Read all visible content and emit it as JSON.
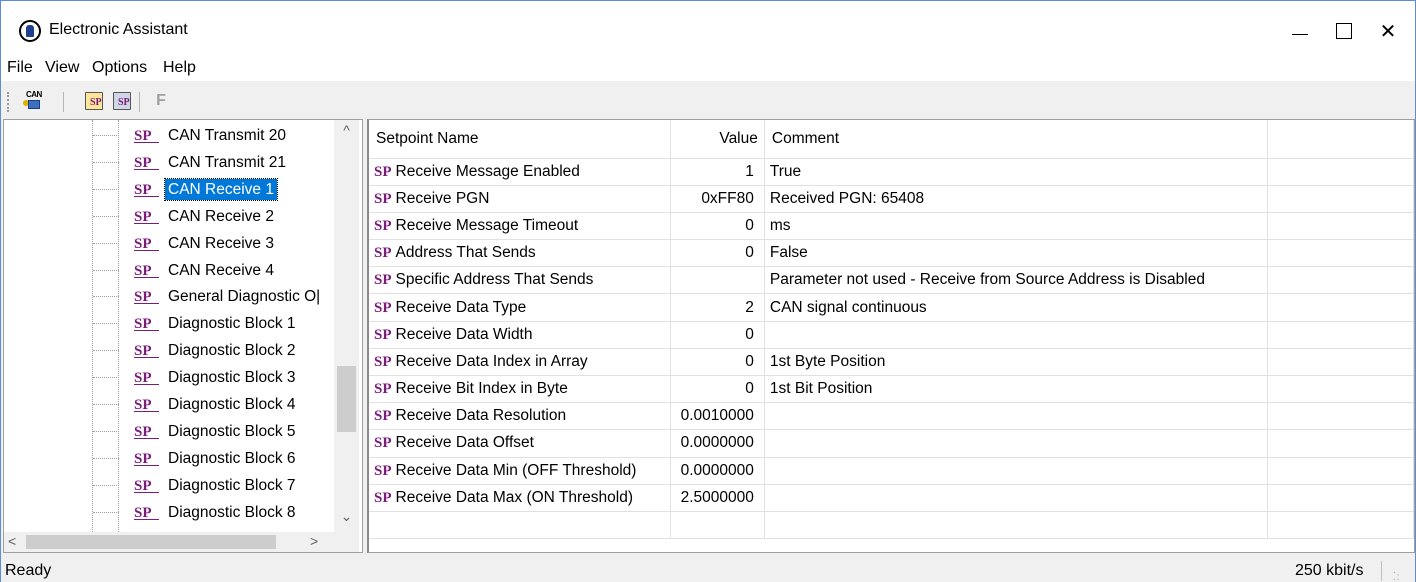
{
  "window": {
    "title": "Electronic Assistant",
    "minimize": "—",
    "maximize": "",
    "close": "✕"
  },
  "menu": [
    "File",
    "View",
    "Options",
    "Help"
  ],
  "toolbar": {
    "can_label": "CAN",
    "open_icon_text": "SP",
    "save_icon_text": "SP",
    "f_label": "F"
  },
  "tree": {
    "icon_text": "SP",
    "items": [
      {
        "label": "CAN Transmit 20",
        "selected": false
      },
      {
        "label": "CAN Transmit 21",
        "selected": false
      },
      {
        "label": "CAN Receive 1",
        "selected": true
      },
      {
        "label": "CAN Receive 2",
        "selected": false
      },
      {
        "label": "CAN Receive 3",
        "selected": false
      },
      {
        "label": "CAN Receive 4",
        "selected": false
      },
      {
        "label": "General Diagnostic O|",
        "selected": false
      },
      {
        "label": "Diagnostic Block 1",
        "selected": false
      },
      {
        "label": "Diagnostic Block 2",
        "selected": false
      },
      {
        "label": "Diagnostic Block 3",
        "selected": false
      },
      {
        "label": "Diagnostic Block 4",
        "selected": false
      },
      {
        "label": "Diagnostic Block 5",
        "selected": false
      },
      {
        "label": "Diagnostic Block 6",
        "selected": false
      },
      {
        "label": "Diagnostic Block 7",
        "selected": false
      },
      {
        "label": "Diagnostic Block 8",
        "selected": false
      }
    ],
    "scroll_up": "^",
    "scroll_down": "⌄",
    "scroll_left": "<",
    "scroll_right": ">"
  },
  "table": {
    "headers": [
      "Setpoint Name",
      "Value",
      "Comment",
      ""
    ],
    "icon_text": "SP",
    "rows": [
      {
        "name": "Receive Message Enabled",
        "value": "1",
        "comment": "True"
      },
      {
        "name": "Receive PGN",
        "value": "0xFF80",
        "comment": "Received PGN: 65408"
      },
      {
        "name": "Receive Message Timeout",
        "value": "0",
        "comment": "ms"
      },
      {
        "name": "Address That Sends",
        "value": "0",
        "comment": "False"
      },
      {
        "name": "Specific Address That Sends",
        "value": "",
        "comment": "Parameter not used - Receive from Source Address is Disabled"
      },
      {
        "name": "Receive Data Type",
        "value": "2",
        "comment": "CAN signal continuous"
      },
      {
        "name": "Receive Data Width",
        "value": "0",
        "comment": ""
      },
      {
        "name": "Receive Data Index in Array",
        "value": "0",
        "comment": "1st Byte Position"
      },
      {
        "name": "Receive Bit Index in Byte",
        "value": "0",
        "comment": "1st Bit Position"
      },
      {
        "name": "Receive Data Resolution",
        "value": "0.0010000",
        "comment": ""
      },
      {
        "name": "Receive Data Offset",
        "value": "0.0000000",
        "comment": ""
      },
      {
        "name": "Receive Data Min (OFF Threshold)",
        "value": "0.0000000",
        "comment": ""
      },
      {
        "name": "Receive Data Max (ON Threshold)",
        "value": "2.5000000",
        "comment": ""
      },
      {
        "name": "",
        "value": "",
        "comment": ""
      }
    ]
  },
  "status": {
    "text": "Ready",
    "bitrate": "250 kbit/s"
  },
  "colors": {
    "selection": "#0078d7",
    "sp_icon": "#7a1d7a",
    "window_border": "#5a8fd6"
  }
}
